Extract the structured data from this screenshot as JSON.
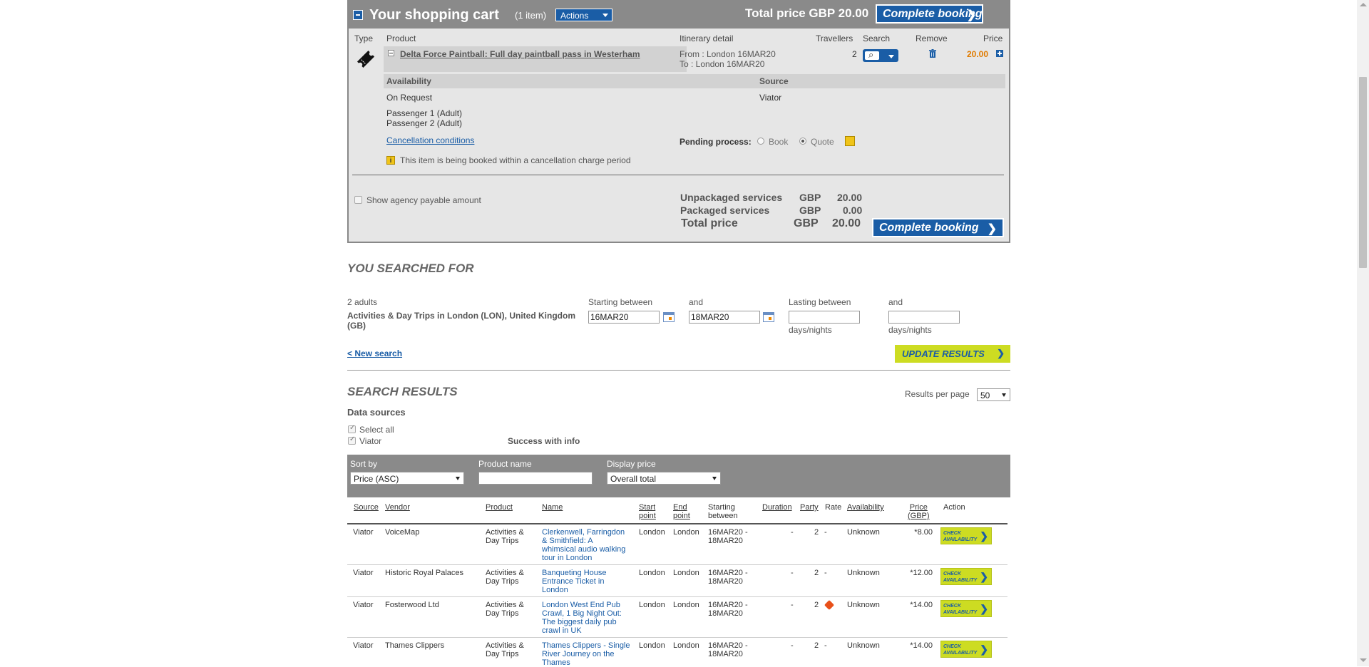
{
  "cart": {
    "title": "Your shopping cart",
    "count": "(1 item)",
    "actions_label": "Actions",
    "total_label": "Total price GBP 20.00",
    "complete_label": "Complete booking",
    "arrow": "❯",
    "columns": {
      "type": "Type",
      "product": "Product",
      "itinerary": "Itinerary detail",
      "travellers": "Travellers",
      "search": "Search",
      "remove": "Remove",
      "price": "Price"
    },
    "item": {
      "name": "Delta Force Paintball: Full day paintball pass in Westerham",
      "from": "From : London 16MAR20",
      "to": "To : London 16MAR20",
      "travellers": "2",
      "price": "20.00"
    },
    "availability_label": "Availability",
    "availability_value": "On Request",
    "source_label": "Source",
    "source_value": "Viator",
    "passengers": [
      "Passenger 1 (Adult)",
      "Passenger 2 (Adult)"
    ],
    "cancellation_link": "Cancellation conditions",
    "pending_label": "Pending process:",
    "book_label": "Book",
    "quote_label": "Quote",
    "warning": "This item is being booked within a cancellation charge period",
    "show_agency": "Show agency payable amount",
    "summary": {
      "unpackaged_label": "Unpackaged services",
      "unpackaged_cur": "GBP",
      "unpackaged_val": "20.00",
      "packaged_label": "Packaged services",
      "packaged_cur": "GBP",
      "packaged_val": "0.00",
      "total_label": "Total price",
      "total_cur": "GBP",
      "total_val": "20.00"
    }
  },
  "searched": {
    "title": "YOU SEARCHED FOR",
    "adults": "2 adults",
    "destination": "Activities & Day Trips in London (LON), United Kingdom (GB)",
    "starting_between": "Starting between",
    "and": "and",
    "start_date": "16MAR20",
    "end_date": "18MAR20",
    "lasting_between": "Lasting between",
    "lasting_and": "and",
    "days_nights": "days/nights",
    "new_search": "< New search",
    "update": "UPDATE RESULTS"
  },
  "results": {
    "title": "SEARCH RESULTS",
    "per_page_label": "Results per page",
    "per_page": "50",
    "data_sources": "Data sources",
    "select_all": "Select all",
    "viator": "Viator",
    "success": "Success with info",
    "sort_by_label": "Sort by",
    "sort_by": "Price (ASC)",
    "product_name_label": "Product name",
    "product_name": "",
    "display_price_label": "Display price",
    "display_price": "Overall total",
    "headers": {
      "source": "Source",
      "vendor": "Vendor",
      "product": "Product",
      "name": "Name",
      "start1": "Start",
      "start2": "point",
      "end1": "End",
      "end2": "point",
      "startb1": "Starting",
      "startb2": "between",
      "duration": "Duration",
      "party": "Party",
      "rate": "Rate",
      "availability": "Availability",
      "price1": "Price",
      "price2": "(GBP)",
      "action": "Action"
    },
    "check_label1": "CHECK",
    "check_label2": "AVAILABILITY",
    "rows": [
      {
        "source": "Viator",
        "vendor": "VoiceMap",
        "product1": "Activities &",
        "product2": "Day Trips",
        "name": [
          "Clerkenwell, Farringdon",
          "& Smithfield: A",
          "whimsical audio walking",
          "tour in London"
        ],
        "start": "London",
        "end": "London",
        "sb1": "16MAR20 -",
        "sb2": "18MAR20",
        "duration": "-",
        "party": "2",
        "rate": "-",
        "availability": "Unknown",
        "price": "*8.00"
      },
      {
        "source": "Viator",
        "vendor": "Historic Royal Palaces",
        "product1": "Activities &",
        "product2": "Day Trips",
        "name": [
          "Banqueting House",
          "Entrance Ticket in",
          "London"
        ],
        "start": "London",
        "end": "London",
        "sb1": "16MAR20 -",
        "sb2": "18MAR20",
        "duration": "-",
        "party": "2",
        "rate": "-",
        "availability": "Unknown",
        "price": "*12.00"
      },
      {
        "source": "Viator",
        "vendor": "Fosterwood Ltd",
        "product1": "Activities &",
        "product2": "Day Trips",
        "name": [
          "London West End Pub",
          "Crawl, 1 Big Night Out:",
          "The biggest daily pub",
          "crawl in UK"
        ],
        "start": "London",
        "end": "London",
        "sb1": "16MAR20 -",
        "sb2": "18MAR20",
        "duration": "-",
        "party": "2",
        "rate": "tag-icon",
        "availability": "Unknown",
        "price": "*14.00"
      },
      {
        "source": "Viator",
        "vendor": "Thames Clippers",
        "product1": "Activities &",
        "product2": "Day Trips",
        "name": [
          "Thames Clippers - Single",
          "River Journey on the",
          "Thames"
        ],
        "start": "London",
        "end": "London",
        "sb1": "16MAR20 -",
        "sb2": "18MAR20",
        "duration": "-",
        "party": "2",
        "rate": "-",
        "availability": "Unknown",
        "price": "*14.00"
      }
    ]
  },
  "colors": {
    "primary": "#1a5da6",
    "header_grey": "#8a8a8a",
    "accent_yellow": "#cddc22",
    "price_orange": "#e07b00"
  }
}
